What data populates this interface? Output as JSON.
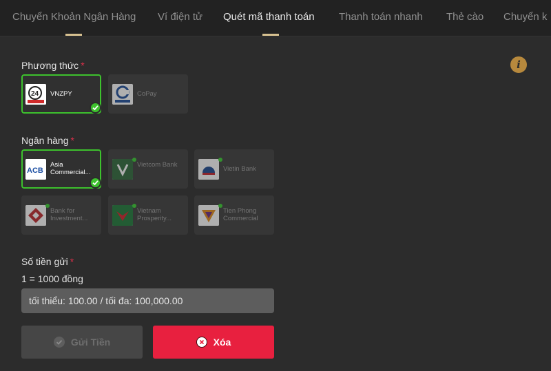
{
  "tabs": [
    {
      "label": "Chuyển Khoản Ngân Hàng",
      "active": false
    },
    {
      "label": "Ví điện tử",
      "active": false
    },
    {
      "label": "Quét mã thanh toán",
      "active": true
    },
    {
      "label": "Thanh toán nhanh",
      "active": false
    },
    {
      "label": "Thẻ cào",
      "active": false
    },
    {
      "label": "Chuyển k",
      "active": false
    }
  ],
  "method": {
    "label": "Phương thức",
    "required": "*",
    "options": [
      {
        "name": "VNZPY",
        "logo_text": "24",
        "logo_sub": "Vnz Pay",
        "selected": true
      },
      {
        "name": "CoPay",
        "logo_text": "C",
        "logo_sub": "COPAY",
        "selected": false
      }
    ]
  },
  "bank": {
    "label": "Ngân hàng",
    "required": "*",
    "options": [
      {
        "name": "Asia Commercial...",
        "logo_text": "ACB",
        "selected": true
      },
      {
        "name": "Vietcom Bank",
        "selected": false
      },
      {
        "name": "Vietin Bank",
        "selected": false
      },
      {
        "name": "Bank for Investment...",
        "selected": false
      },
      {
        "name": "Vietnam Prosperity...",
        "selected": false
      },
      {
        "name": "Tien Phong Commercial",
        "selected": false
      }
    ]
  },
  "amount": {
    "label": "Số tiền gửi",
    "required": "*",
    "rate": "1 = 1000 đồng",
    "placeholder": "tối thiểu: 100.00 / tối đa: 100,000.00"
  },
  "actions": {
    "send_label": "Gửi Tiền",
    "clear_label": "Xóa"
  },
  "colors": {
    "selected_border": "#3dc22d",
    "accent_underline": "#d7c190",
    "danger": "#e8203f",
    "info": "#b7893d"
  }
}
